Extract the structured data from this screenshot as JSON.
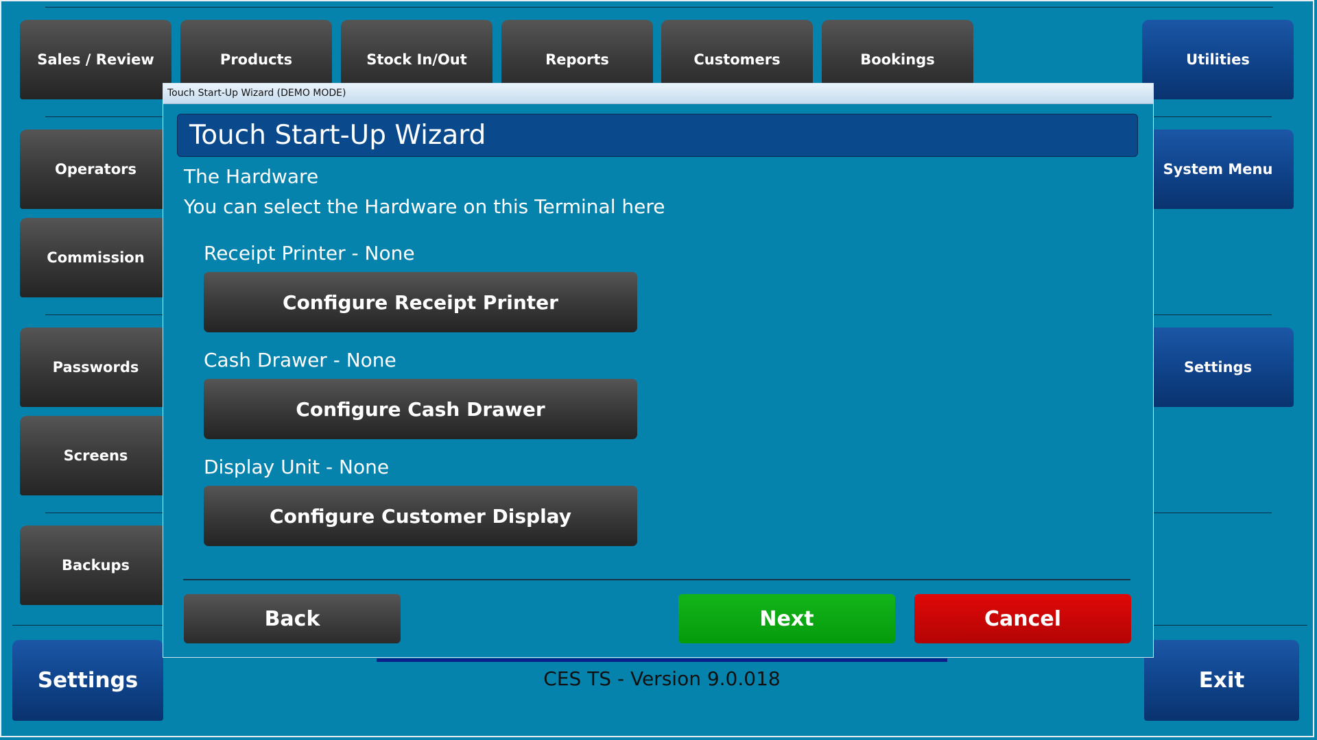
{
  "top_nav": {
    "sales_review": "Sales / Review",
    "products": "Products",
    "stock_in_out": "Stock In/Out",
    "reports": "Reports",
    "customers": "Customers",
    "bookings": "Bookings",
    "utilities": "Utilities"
  },
  "left_nav": {
    "operators": "Operators",
    "commission": "Commission",
    "passwords": "Passwords",
    "screens": "Screens",
    "backups": "Backups",
    "settings": "Settings"
  },
  "right_nav": {
    "system_menu": "System Menu",
    "settings": "Settings",
    "exit": "Exit"
  },
  "footer": {
    "version": "CES TS - Version 9.0.018"
  },
  "dialog": {
    "window_title": "Touch Start-Up Wizard (DEMO MODE)",
    "banner": "Touch Start-Up Wizard",
    "heading": "The Hardware",
    "description": "You can select the Hardware on this Terminal here",
    "receipt_printer_status": "Receipt Printer - None",
    "receipt_printer_button": "Configure Receipt Printer",
    "cash_drawer_status": "Cash Drawer - None",
    "cash_drawer_button": "Configure Cash Drawer",
    "display_unit_status": "Display Unit - None",
    "display_unit_button": "Configure Customer Display",
    "back_button": "Back",
    "next_button": "Next",
    "cancel_button": "Cancel"
  },
  "colors": {
    "background": "#0583ad",
    "next": "#0aa412",
    "cancel": "#c80606",
    "banner": "#0a4a8c"
  }
}
